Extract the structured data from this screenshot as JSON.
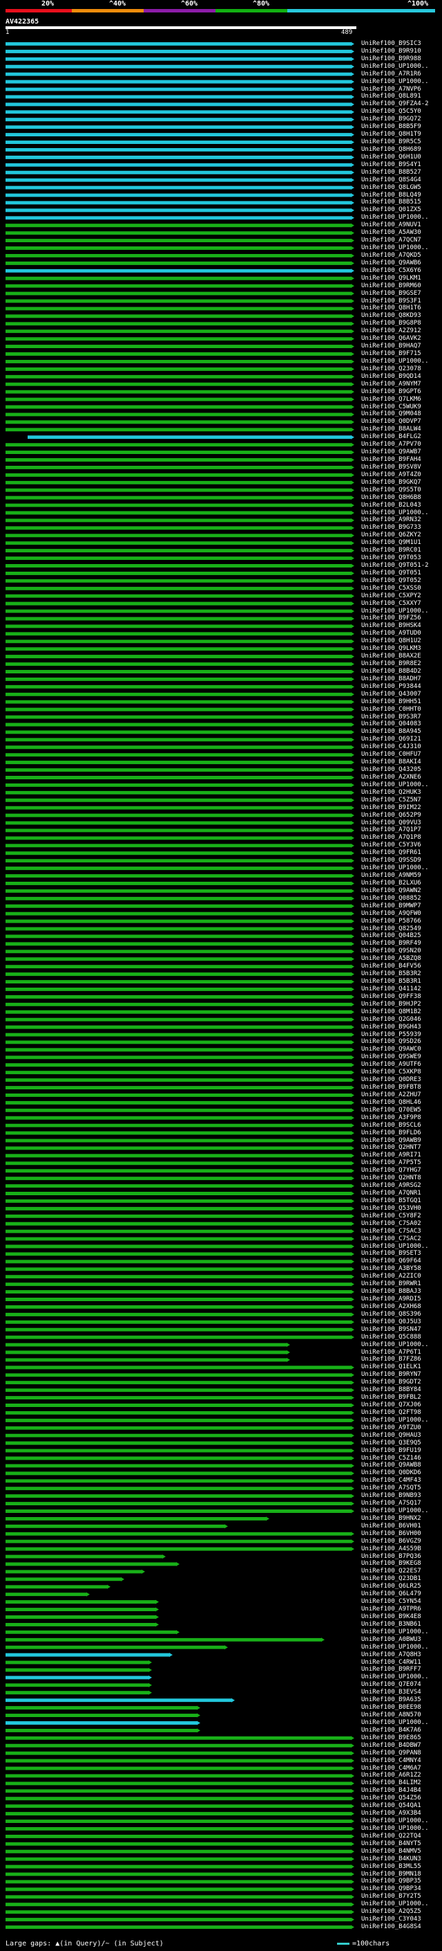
{
  "scale": {
    "ticks": [
      {
        "label": "20%",
        "color": "#e8101c"
      },
      {
        "label": "^40%",
        "color": "#f08c0c"
      },
      {
        "label": "^60%",
        "color": "#8c1ca8"
      },
      {
        "label": "^80%",
        "color": "#12b012"
      },
      {
        "label": "^100%",
        "color": "#28c8dc"
      }
    ]
  },
  "query": {
    "name": "AV422365",
    "start": "1",
    "end": "489"
  },
  "footer": {
    "large_gaps": "Large gaps: ▲(in Query)/~ (in Subject)",
    "legend_text": "=100chars"
  },
  "colors": {
    "cyan": "#22c7dc",
    "green": "#18b018",
    "purple": "#c040c0"
  },
  "hits": [
    "UniRef100_B9SIC3",
    "UniRef100_B9R910",
    "UniRef100_B9R988",
    "UniRef100_UP1000..",
    "UniRef100_A7R1R6",
    "UniRef100_UP1000..",
    "UniRef100_A7NVP6",
    "UniRef100_Q8L891",
    "UniRef100_Q9FZA4-2",
    "UniRef100_Q5C5Y0",
    "UniRef100_B9GQ72",
    "UniRef100_B8B5F9",
    "UniRef100_Q8H1T9",
    "UniRef100_B9R5C5",
    "UniRef100_Q8H689",
    "UniRef100_Q6H1U0",
    "UniRef100_B9S4Y1",
    "UniRef100_B8B527",
    "UniRef100_Q8S4G4",
    "UniRef100_Q8LGW5",
    "UniRef100_B8LQ49",
    "UniRef100_B8B515",
    "UniRef100_Q01ZX5",
    "UniRef100_UP1000..",
    "UniRef100_A9NUV1",
    "UniRef100_A5AW30",
    "UniRef100_A7QCN7",
    "UniRef100_UP1000..",
    "UniRef100_A7QKD5",
    "UniRef100_Q9AWB6",
    "UniRef100_C5X6Y6",
    "UniRef100_Q9LKM1",
    "UniRef100_B9RM60",
    "UniRef100_B9GSE7",
    "UniRef100_B9S3F1",
    "UniRef100_Q8H1T6",
    "UniRef100_Q8KD93",
    "UniRef100_B9G8P8",
    "UniRef100_A2Z912",
    "UniRef100_Q6AVK2",
    "UniRef100_B9HAQ7",
    "UniRef100_B9F715",
    "UniRef100_UP1000..",
    "UniRef100_Q23078",
    "UniRef100_B9QD14",
    "UniRef100_A9NYM7",
    "UniRef100_B9GPT6",
    "UniRef100_Q7LKM6",
    "UniRef100_C5WUK9",
    "UniRef100_Q9M048",
    "UniRef100_Q0DVP7",
    "UniRef100_B8ALW4",
    "UniRef100_B4FLG2",
    "UniRef100_A7PV70",
    "UniRef100_Q9AWB7",
    "UniRef100_B9FAH4",
    "UniRef100_B9SV8V",
    "UniRef100_A9T4Z0",
    "UniRef100_B9GKQ7",
    "UniRef100_Q9S5T0",
    "UniRef100_Q8H6B8",
    "UniRef100_B2L043",
    "UniRef100_UP1000..",
    "UniRef100_A9RN32",
    "UniRef100_B9G733",
    "UniRef100_Q6ZKY2",
    "UniRef100_Q9M1U1",
    "UniRef100_B9RC01",
    "UniRef100_Q9T053",
    "UniRef100_Q9T051-2",
    "UniRef100_Q9T051",
    "UniRef100_Q9T052",
    "UniRef100_C5XSS0",
    "UniRef100_C5XPY2",
    "UniRef100_C5XXY7",
    "UniRef100_UP1000..",
    "UniRef100_B9FZ56",
    "UniRef100_B9HSK4",
    "UniRef100_A9TUD0",
    "UniRef100_Q8H1U2",
    "UniRef100_Q9LKM3",
    "UniRef100_B8AX2E",
    "UniRef100_B9R8E2",
    "UniRef100_B8B4D2",
    "UniRef100_B8ADH7",
    "UniRef100_P93844",
    "UniRef100_Q43007",
    "UniRef100_B9HH51",
    "UniRef100_C0HHT0",
    "UniRef100_B9S3R7",
    "UniRef100_Q04083",
    "UniRef100_B8A945",
    "UniRef100_Q69I21",
    "UniRef100_C4J310",
    "UniRef100_C0HFU7",
    "UniRef100_B8AKI4",
    "UniRef100_Q43205",
    "UniRef100_A2XNE6",
    "UniRef100_UP1000..",
    "UniRef100_Q2HUK3",
    "UniRef100_C5Z5N7",
    "UniRef100_B9IM22",
    "UniRef100_Q652P9",
    "UniRef100_Q09VU3",
    "UniRef100_A7Q1P7",
    "UniRef100_A7Q1P8",
    "UniRef100_C5Y3V6",
    "UniRef100_Q9FR61",
    "UniRef100_Q9SSD9",
    "UniRef100_UP1000..",
    "UniRef100_A9NM59",
    "UniRef100_B2LXU6",
    "UniRef100_Q9AWN2",
    "UniRef100_Q08852",
    "UniRef100_B9MWP7",
    "UniRef100_A9QFW0",
    "UniRef100_P58766",
    "UniRef100_Q82549",
    "UniRef100_Q04B25",
    "UniRef100_B9RF49",
    "UniRef100_Q9SN20",
    "UniRef100_A5BZQ8",
    "UniRef100_B4FV56",
    "UniRef100_B5B3R2",
    "UniRef100_B5B3R1",
    "UniRef100_Q41142",
    "UniRef100_Q9FF38",
    "UniRef100_B9HJP2",
    "UniRef100_Q8M1B2",
    "UniRef100_Q2G046",
    "UniRef100_B9GH43",
    "UniRef100_P55939",
    "UniRef100_Q9SD26",
    "UniRef100_Q9AWC0",
    "UniRef100_Q9SWE9",
    "UniRef100_A9UTF6",
    "UniRef100_C5XKP8",
    "UniRef100_Q0DRE3",
    "UniRef100_B9FBT8",
    "UniRef100_A2ZHU7",
    "UniRef100_Q8HL46",
    "UniRef100_Q70EW5",
    "UniRef100_A3F9P8",
    "UniRef100_B9SCL6",
    "UniRef100_B9FLD6",
    "UniRef100_Q9AWB9",
    "UniRef100_Q2HNT7",
    "UniRef100_A9RI71",
    "UniRef100_A7P5T5",
    "UniRef100_Q7YHG7",
    "UniRef100_Q2HNT8",
    "UniRef100_A9RSG2",
    "UniRef100_A7QNR1",
    "UniRef100_B5TGQ1",
    "UniRef100_Q53VH0",
    "UniRef100_C5Y8F2",
    "UniRef100_C7SA02",
    "UniRef100_C7SAC3",
    "UniRef100_C7SAC2",
    "UniRef100_UP1000..",
    "UniRef100_B9SET3",
    "UniRef100_Q69F64",
    "UniRef100_A3BY58",
    "UniRef100_A2ZIC0",
    "UniRef100_B9RWR1",
    "UniRef100_B8BAJ3",
    "UniRef100_A9RDI5",
    "UniRef100_A2XH68",
    "UniRef100_Q8S396",
    "UniRef100_Q0J5U3",
    "UniRef100_B9SN47",
    "UniRef100_Q5C888",
    "UniRef100_UP1000..",
    "UniRef100_A7P6T1",
    "UniRef100_B7FZ86",
    "UniRef100_Q1ELK1",
    "UniRef100_B9RYN7",
    "UniRef100_B9GDT2",
    "UniRef100_B8BY84",
    "UniRef100_B9FBL2",
    "UniRef100_Q7XJ06",
    "UniRef100_Q2FT98",
    "UniRef100_UP1000..",
    "UniRef100_A9TZU0",
    "UniRef100_Q9HAU3",
    "UniRef100_Q3E9Q5",
    "UniRef100_B9FU19",
    "UniRef100_C5Z146",
    "UniRef100_Q9AWB8",
    "UniRef100_Q0DKD6",
    "UniRef100_C4MF43",
    "UniRef100_A7SQT5",
    "UniRef100_B9NB93",
    "UniRef100_A7SQ17",
    "UniRef100_UP1000..",
    "UniRef100_B9HNX2",
    "UniRef100_B6VH01",
    "UniRef100_B6VH00",
    "UniRef100_B6VGZ9",
    "UniRef100_A4S59B",
    "UniRef100_B7PQ36",
    "UniRef100_B9KEG8",
    "UniRef100_Q22ES7",
    "UniRef100_Q23DB1",
    "UniRef100_Q6LR25",
    "UniRef100_Q6L479",
    "UniRef100_C5YN54",
    "UniRef100_A9TPR6",
    "UniRef100_B9K4E8",
    "UniRef100_B3NB61",
    "UniRef100_UP1000..",
    "UniRef100_A0BWU3",
    "UniRef100_UP1000..",
    "UniRef100_A7Q8H3",
    "UniRef100_C4RW11",
    "UniRef100_B9RFF7",
    "UniRef100_UP1000..",
    "UniRef100_Q7E074",
    "UniRef100_B3EVS4",
    "UniRef100_B9A635",
    "UniRef100_B0EE98",
    "UniRef100_A8N570",
    "UniRef100_UP1000..",
    "UniRef100_B4K7A6",
    "UniRef100_B9E865",
    "UniRef100_B4DBW7",
    "UniRef100_Q9PAN8",
    "UniRef100_C4MNY4",
    "UniRef100_C4M6A7",
    "UniRef100_A6R1Z2",
    "UniRef100_B4LIM2",
    "UniRef100_B4J4B4",
    "UniRef100_Q54Z56",
    "UniRef100_Q54QA1",
    "UniRef100_A9X3B4",
    "UniRef100_UP1000..",
    "UniRef100_UP1000..",
    "UniRef100_Q22TQ4",
    "UniRef100_B4NYT5",
    "UniRef100_B4NMV5",
    "UniRef100_B4KUN3",
    "UniRef100_B3ML55",
    "UniRef100_B9MN18",
    "UniRef100_Q9BP35",
    "UniRef100_Q9BP34",
    "UniRef100_B7Y2T5",
    "UniRef100_UP1000..",
    "UniRef100_A2Q5Z5",
    "UniRef100_C3Y043",
    "UniRef100_B4G8S4"
  ]
}
